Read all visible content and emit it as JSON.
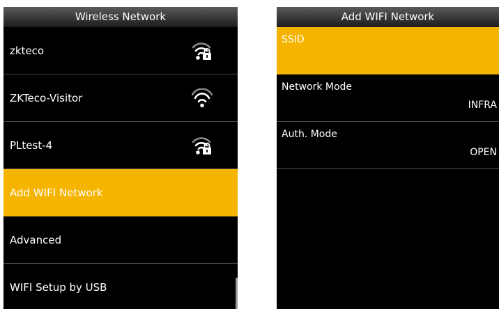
{
  "left_screen": {
    "title": "Wireless Network",
    "items": [
      {
        "label": "zkteco",
        "icon": "wifi-locked-icon"
      },
      {
        "label": "ZKTeco-Visitor",
        "icon": "wifi-icon"
      },
      {
        "label": "PLtest-4",
        "icon": "wifi-locked-icon"
      },
      {
        "label": "Add WIFI Network",
        "selected": true
      },
      {
        "label": "Advanced"
      },
      {
        "label": "WIFI Setup by USB"
      }
    ]
  },
  "right_screen": {
    "title": "Add WIFI Network",
    "fields": [
      {
        "label": "SSID",
        "value": "",
        "selected": true
      },
      {
        "label": "Network Mode",
        "value": "INFRA"
      },
      {
        "label": "Auth. Mode",
        "value": "OPEN"
      }
    ]
  },
  "colors": {
    "highlight": "#f5b400",
    "background": "#000000",
    "text": "#ffffff",
    "icon_strong": "#ffffff",
    "icon_faded": "#8a8a8a"
  }
}
